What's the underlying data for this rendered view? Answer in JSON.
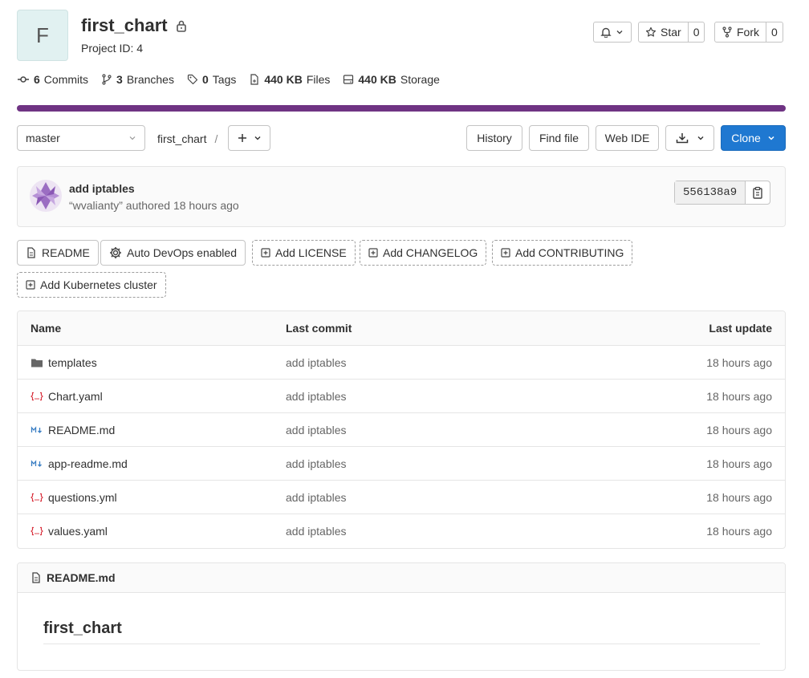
{
  "project": {
    "avatar_letter": "F",
    "title": "first_chart",
    "id_text": "Project ID: 4"
  },
  "actions": {
    "star_label": "Star",
    "star_count": "0",
    "fork_label": "Fork",
    "fork_count": "0"
  },
  "stats": {
    "commits_num": "6",
    "commits_label": "Commits",
    "branches_num": "3",
    "branches_label": "Branches",
    "tags_num": "0",
    "tags_label": "Tags",
    "files_num": "440 KB",
    "files_label": "Files",
    "storage_num": "440 KB",
    "storage_label": "Storage"
  },
  "toolbar": {
    "branch": "master",
    "crumb": "first_chart",
    "crumb_sep": "/",
    "history": "History",
    "find_file": "Find file",
    "web_ide": "Web IDE",
    "clone": "Clone"
  },
  "commit": {
    "title": "add iptables",
    "meta": "“wvalianty” authored 18 hours ago",
    "sha": "556138a9"
  },
  "pills": {
    "readme": "README",
    "autodevops": "Auto DevOps enabled",
    "license": "Add LICENSE",
    "changelog": "Add CHANGELOG",
    "contributing": "Add CONTRIBUTING",
    "kubernetes": "Add Kubernetes cluster"
  },
  "table": {
    "headers": {
      "name": "Name",
      "commit": "Last commit",
      "update": "Last update"
    },
    "rows": [
      {
        "name": "templates",
        "icon": "folder-icon",
        "commit": "add iptables",
        "update": "18 hours ago"
      },
      {
        "name": "Chart.yaml",
        "icon": "yaml-file-icon",
        "commit": "add iptables",
        "update": "18 hours ago"
      },
      {
        "name": "README.md",
        "icon": "markdown-file-icon",
        "commit": "add iptables",
        "update": "18 hours ago"
      },
      {
        "name": "app-readme.md",
        "icon": "markdown-file-icon",
        "commit": "add iptables",
        "update": "18 hours ago"
      },
      {
        "name": "questions.yml",
        "icon": "yaml-file-icon",
        "commit": "add iptables",
        "update": "18 hours ago"
      },
      {
        "name": "values.yaml",
        "icon": "yaml-file-icon",
        "commit": "add iptables",
        "update": "18 hours ago"
      }
    ]
  },
  "readme": {
    "filename": "README.md",
    "heading": "first_chart"
  },
  "colors": {
    "accent_bar": "#6f3383",
    "clone_button": "#1f78d1",
    "yaml_icon": "#d9333f",
    "markdown_icon": "#3b7fc4"
  }
}
